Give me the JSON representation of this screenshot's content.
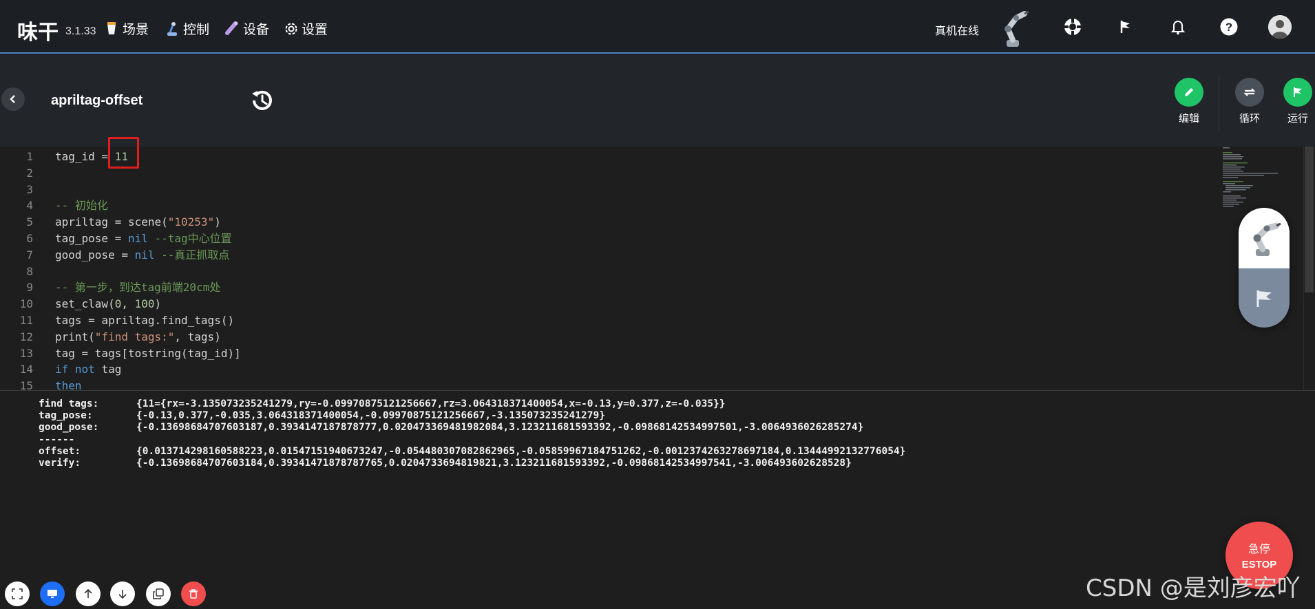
{
  "topnav": {
    "brand": "味干",
    "version": "3.1.33",
    "items": [
      {
        "label": "场景",
        "icon": "cup-icon"
      },
      {
        "label": "控制",
        "icon": "joystick-icon"
      },
      {
        "label": "设备",
        "icon": "device-icon"
      },
      {
        "label": "设置",
        "icon": "gear-icon"
      }
    ],
    "status": "真机在线"
  },
  "header": {
    "title": "apriltag-offset",
    "actions": [
      {
        "label": "编辑",
        "color": "#1fc466"
      },
      {
        "label": "循环",
        "color": "#4a5059"
      },
      {
        "label": "运行",
        "color": "#1fc466"
      }
    ]
  },
  "editor": {
    "lines": [
      {
        "n": "1",
        "html": "tag_id = <span class=\"c-num\">11</span>"
      },
      {
        "n": "2",
        "html": ""
      },
      {
        "n": "3",
        "html": ""
      },
      {
        "n": "4",
        "html": "<span class=\"c-cmt\">-- 初始化</span>"
      },
      {
        "n": "5",
        "html": "apriltag = scene(<span class=\"c-str\">\"10253\"</span>)"
      },
      {
        "n": "6",
        "html": "tag_pose = <span class=\"c-kw\">nil</span> <span class=\"c-cmt\">--tag中心位置</span>"
      },
      {
        "n": "7",
        "html": "good_pose = <span class=\"c-kw\">nil</span> <span class=\"c-cmt\">--真正抓取点</span>"
      },
      {
        "n": "8",
        "html": ""
      },
      {
        "n": "9",
        "html": "<span class=\"c-cmt\">-- 第一步，到达tag前端20cm处</span>"
      },
      {
        "n": "10",
        "html": "set_claw(<span class=\"c-num\">0</span>, <span class=\"c-num\">100</span>)"
      },
      {
        "n": "11",
        "html": "tags = apriltag.find_tags()"
      },
      {
        "n": "12",
        "html": "print(<span class=\"c-str\">\"find tags:\"</span>, tags)"
      },
      {
        "n": "13",
        "html": "tag = tags[tostring(tag_id)]"
      },
      {
        "n": "14",
        "html": "<span class=\"c-kw\">if</span> <span class=\"c-kw\">not</span> tag"
      },
      {
        "n": "15",
        "html": "<span class=\"c-kw\">then</span>"
      }
    ]
  },
  "console": {
    "lines": [
      {
        "key": "find tags:",
        "val": "{11={rx=-3.135073235241279,ry=-0.09970875121256667,rz=3.064318371400054,x=-0.13,y=0.377,z=-0.035}}"
      },
      {
        "key": "tag_pose:",
        "val": "{-0.13,0.377,-0.035,3.064318371400054,-0.09970875121256667,-3.135073235241279}"
      },
      {
        "key": "good_pose:",
        "val": "{-0.13698684707603187,0.3934147187878777,0.020473369481982084,3.123211681593392,-0.09868142534997501,-3.0064936026285274}"
      },
      {
        "key": "------",
        "val": ""
      },
      {
        "key": "offset:",
        "val": "{0.013714298160588223,0.01547151940673247,-0.054480307082862965,-0.05859967184751262,-0.0012374263278697184,0.13444992132776054}"
      },
      {
        "key": "verify:",
        "val": "{-0.13698684707603184,0.39341471878787765,0.0204733694819821,3.123211681593392,-0.09868142534997541,-3.006493602628528}"
      }
    ]
  },
  "estop": {
    "line1": "急停",
    "line2": "ESTOP"
  },
  "watermark": "CSDN @是刘彦宏吖"
}
